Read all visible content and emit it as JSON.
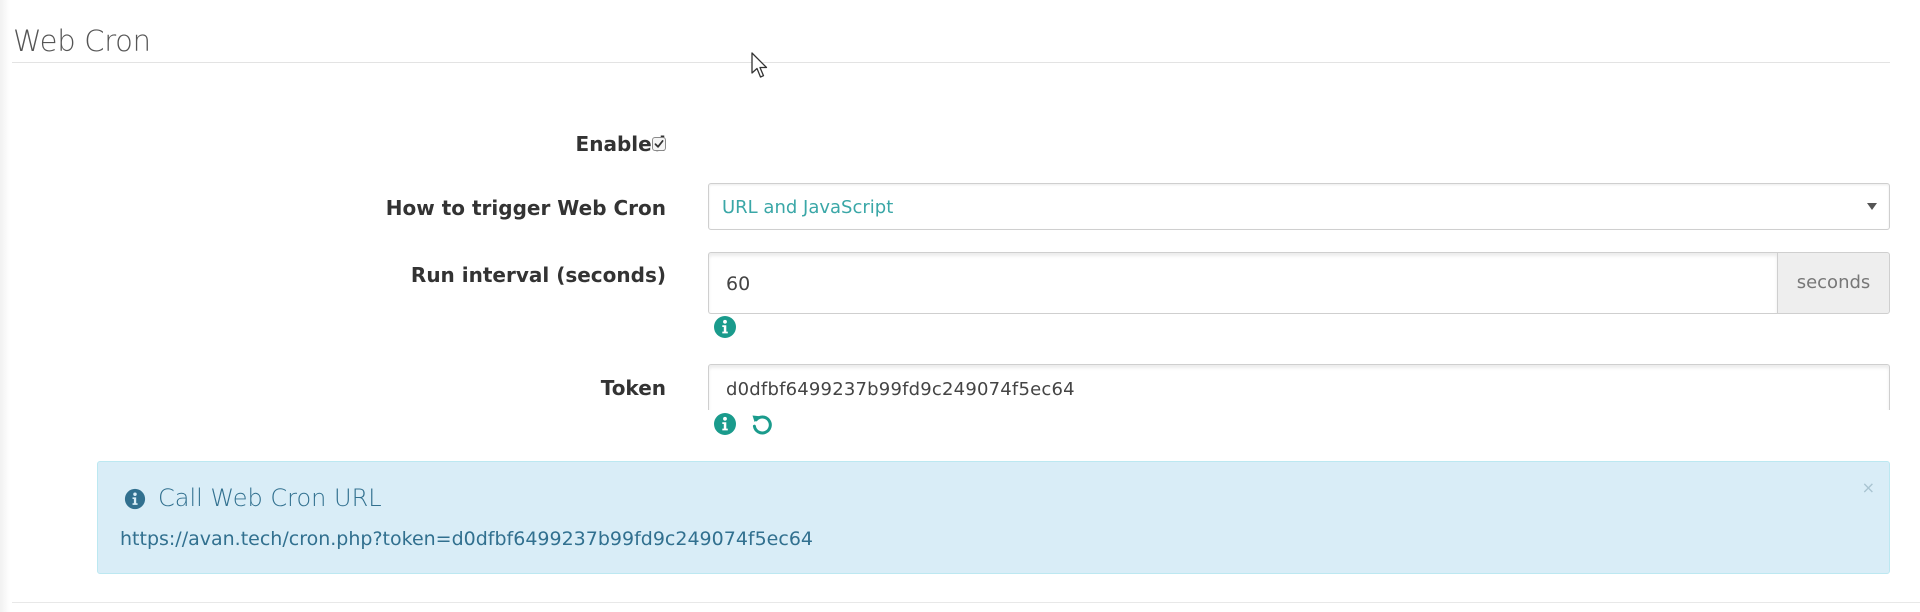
{
  "section": {
    "title": "Web Cron"
  },
  "form": {
    "enabled": {
      "label": "Enabled",
      "checked": true
    },
    "trigger": {
      "label": "How to trigger Web Cron",
      "value": "URL and JavaScript"
    },
    "interval": {
      "label": "Run interval (seconds)",
      "value": "60",
      "addon": "seconds"
    },
    "token": {
      "label": "Token",
      "value": "d0dfbf6499237b99fd9c249074f5ec64"
    }
  },
  "alert": {
    "title": "Call Web Cron URL",
    "text": "https://avan.tech/cron.php?token=d0dfbf6499237b99fd9c249074f5ec64",
    "close": "×"
  },
  "colors": {
    "accent": "#1a9b8c",
    "alert_bg": "#d9edf7",
    "alert_text": "#31708f"
  },
  "icons": [
    "info-icon",
    "reset-icon",
    "close-icon",
    "caret-down-icon",
    "mouse-cursor-icon"
  ]
}
